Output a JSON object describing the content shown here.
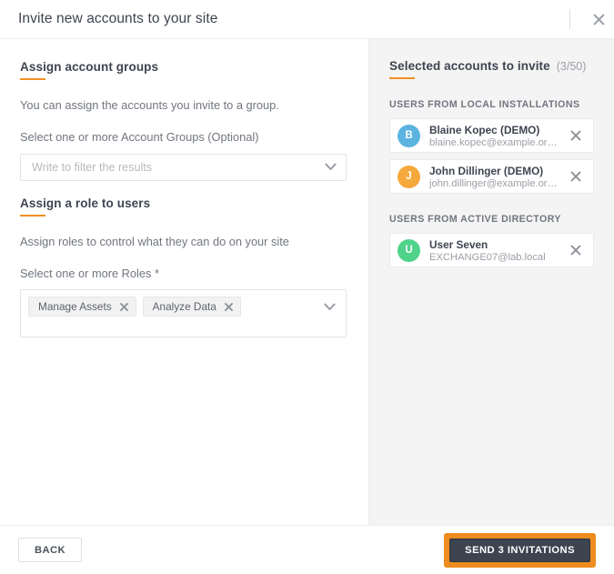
{
  "header": {
    "title": "Invite new accounts to your site",
    "close_icon": "close-icon"
  },
  "left_pane": {
    "groups_section": {
      "heading": "Assign account groups",
      "description": "You can assign the accounts you invite to a group.",
      "field_label": "Select one or more Account Groups (Optional)",
      "filter_placeholder": "Write to filter the results",
      "caret_icon": "chevron-down-icon"
    },
    "roles_section": {
      "heading": "Assign a role to users",
      "description": "Assign roles to control what they can do on your site",
      "field_label": "Select one or more Roles *",
      "caret_icon": "chevron-down-icon",
      "chips": [
        {
          "label": "Manage Assets",
          "remove_icon": "close-icon"
        },
        {
          "label": "Analyze Data",
          "remove_icon": "close-icon"
        }
      ]
    }
  },
  "right_pane": {
    "heading": "Selected accounts to invite",
    "count": "(3/50)",
    "groups": [
      {
        "title": "USERS FROM LOCAL INSTALLATIONS",
        "users": [
          {
            "initial": "B",
            "avatar_color": "#5bb3e0",
            "name": "Blaine Kopec (DEMO)",
            "email": "blaine.kopec@example.org.in...",
            "remove_icon": "close-icon"
          },
          {
            "initial": "J",
            "avatar_color": "#f5a83c",
            "name": "John Dillinger (DEMO)",
            "email": "john.dillinger@example.org.in...",
            "remove_icon": "close-icon"
          }
        ]
      },
      {
        "title": "USERS FROM ACTIVE DIRECTORY",
        "users": [
          {
            "initial": "U",
            "avatar_color": "#4fd38a",
            "name": "User Seven",
            "email": "EXCHANGE07@lab.local",
            "remove_icon": "close-icon"
          }
        ]
      }
    ]
  },
  "footer": {
    "back_label": "BACK",
    "send_label": "SEND 3 INVITATIONS"
  },
  "colors": {
    "accent_orange": "#f19021",
    "focus_orange": "#ef8c1f",
    "dark_button": "#3d4450",
    "panel_gray": "#f4f4f4"
  }
}
